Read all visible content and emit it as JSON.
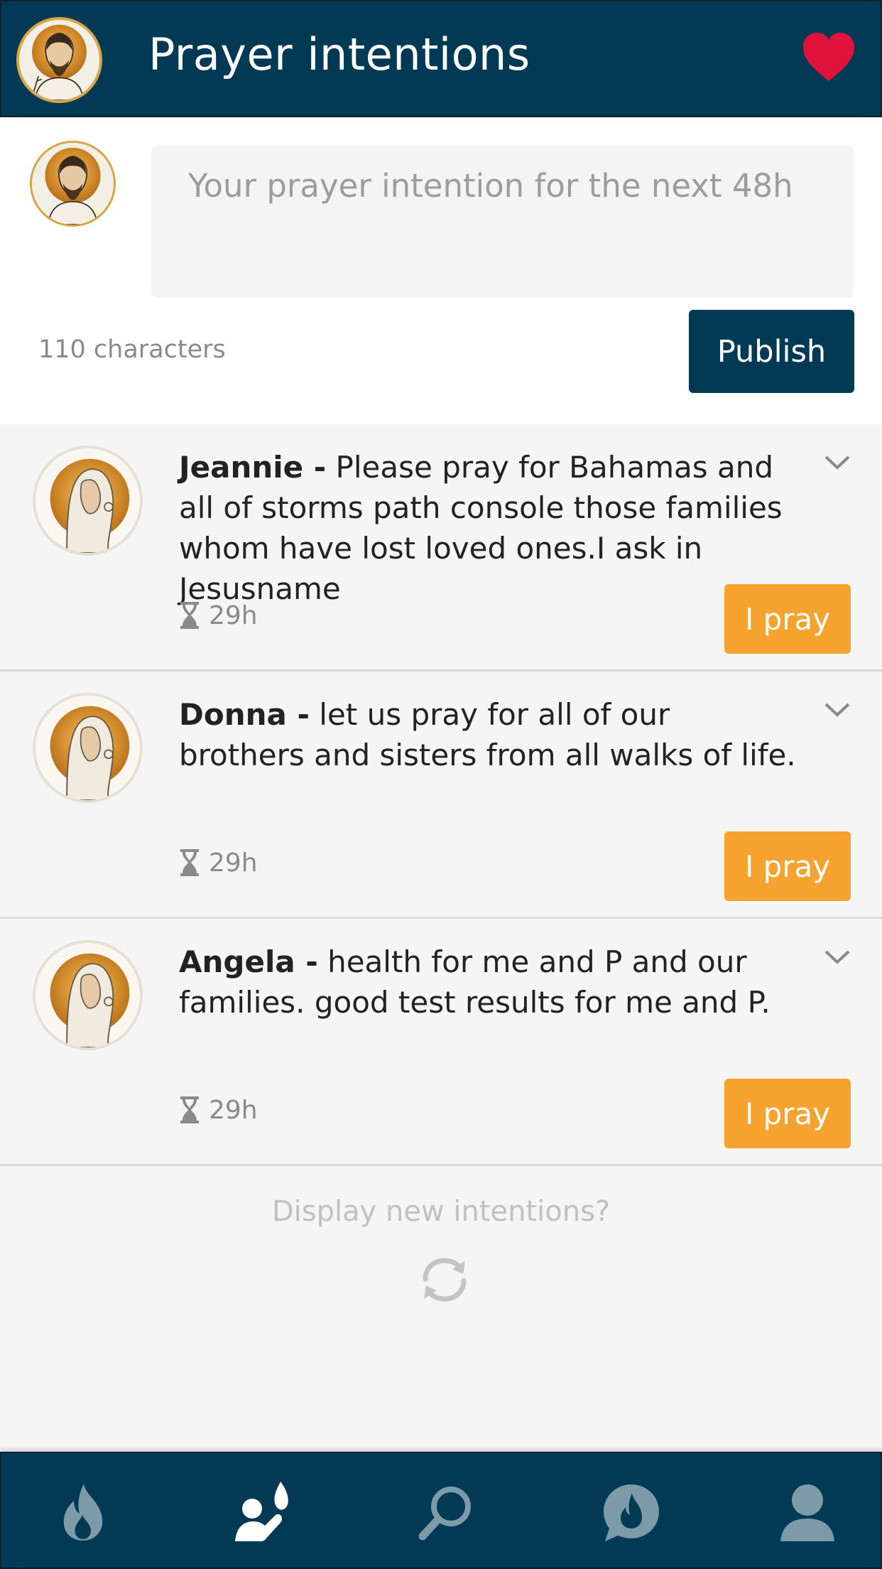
{
  "header": {
    "title": "Prayer intentions",
    "favorite_icon": "heart-icon",
    "heart_color": "#e0133c",
    "background": "#023a55"
  },
  "compose": {
    "placeholder": "Your prayer intention for the next 48h",
    "value": "",
    "char_count": "110 characters",
    "publish_label": "Publish"
  },
  "intentions": [
    {
      "name": "Jeannie -",
      "text": " Please pray for Bahamas and all of storms path console those families whom have lost loved ones.I ask in Jesusname",
      "time_left": "29h",
      "pray_label": "I pray"
    },
    {
      "name": "Donna -",
      "text": "  let us pray for all of our brothers and sisters from all walks of life.",
      "time_left": "29h",
      "pray_label": "I pray"
    },
    {
      "name": "Angela -",
      "text": "  health for me and P and our families. good test results for me and P.",
      "time_left": "29h",
      "pray_label": "I pray"
    }
  ],
  "refresh": {
    "label": "Display new intentions?",
    "icon": "refresh-icon"
  },
  "colors": {
    "accent": "#f6a22f",
    "primary": "#023a55"
  },
  "bottom_nav": {
    "items": [
      {
        "icon": "flame-icon",
        "active": false
      },
      {
        "icon": "praying-person-icon",
        "active": true
      },
      {
        "icon": "search-icon",
        "active": false
      },
      {
        "icon": "chat-flame-icon",
        "active": false
      },
      {
        "icon": "profile-icon",
        "active": false
      }
    ]
  }
}
